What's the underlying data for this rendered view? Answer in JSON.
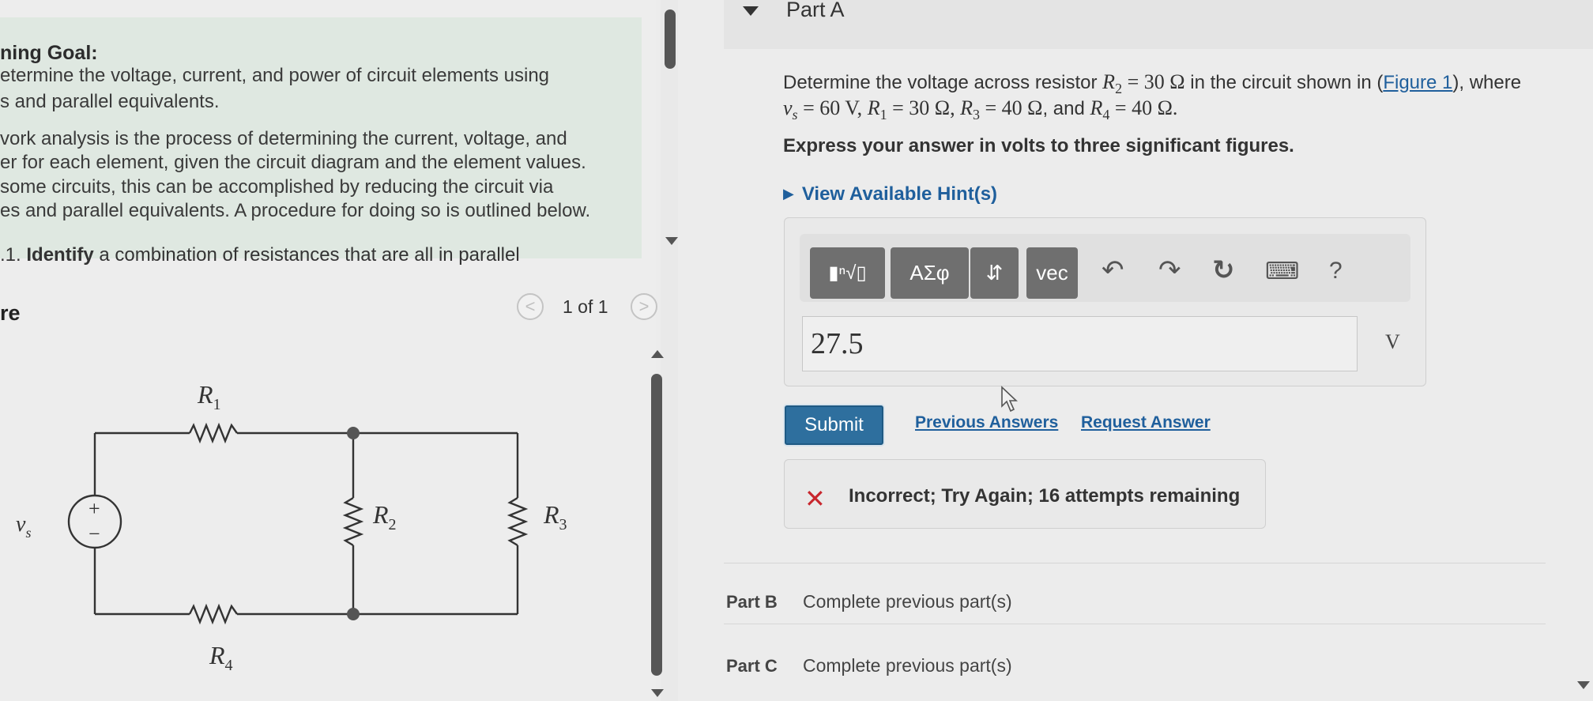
{
  "learning_goal": {
    "title": "ning Goal:",
    "lines": [
      "etermine the voltage, current, and power of circuit elements using",
      "s and parallel equivalents."
    ],
    "paragraph": [
      "vork analysis is the process of determining the current, voltage, and",
      "er for each element, given the circuit diagram and the element values.",
      "some circuits, this can be accomplished by reducing the circuit via",
      "es and parallel equivalents. A procedure for doing so is outlined below."
    ],
    "step": {
      "number": ".1.",
      "bold": "Identify",
      "rest": "a combination of resistances that are all in parallel"
    }
  },
  "figure": {
    "label": "re",
    "pager": "1 of 1",
    "prev_glyph": "<",
    "next_glyph": ">",
    "circuit": {
      "source_label": "v",
      "source_sub": "s",
      "plus": "+",
      "minus": "−",
      "r1": "R",
      "r1_sub": "1",
      "r2": "R",
      "r2_sub": "2",
      "r3": "R",
      "r3_sub": "3",
      "r4": "R",
      "r4_sub": "4"
    }
  },
  "part_a": {
    "title": "Part A",
    "question_line1_prefix": "Determine the voltage across resistor ",
    "question_line1_r2": "R",
    "question_line1_r2_sub": "2",
    "question_line1_value": " = 30 Ω",
    "question_line1_mid": " in the circuit shown in (",
    "figure_link": "Figure 1",
    "question_line1_suffix": "), where",
    "q2_vs": "v",
    "q2_vs_sub": "s",
    "q2_vs_val": " = 60 V, ",
    "q2_r1": "R",
    "q2_r1_sub": "1",
    "q2_r1_val": " = 30 Ω, ",
    "q2_r3": "R",
    "q2_r3_sub": "3",
    "q2_r3_val": " = 40 Ω",
    "q2_and": ", and ",
    "q2_r4": "R",
    "q2_r4_sub": "4",
    "q2_r4_val": " = 40 Ω.",
    "instruction": "Express your answer in volts to three significant figures.",
    "hint_glyph": "▶",
    "hint": "View Available Hint(s)",
    "toolbar": {
      "templates_glyph": "▮ⁿ√▯",
      "greek": "ΑΣφ",
      "arrows": "⇵",
      "vec": "vec",
      "undo_glyph": "↶",
      "redo_glyph": "↷",
      "reset_glyph": "↻",
      "keyboard_glyph": "⌨",
      "help": "?"
    },
    "answer_value": "27.5",
    "unit": "V",
    "submit": "Submit",
    "previous_answers": "Previous Answers",
    "request_answer": "Request Answer",
    "feedback_glyph": "✕",
    "feedback": "Incorrect; Try Again; 16 attempts remaining"
  },
  "part_b": {
    "label": "Part B",
    "status": "Complete previous part(s)"
  },
  "part_c": {
    "label": "Part C",
    "status": "Complete previous part(s)"
  },
  "colors": {
    "goal_bg": "#dfe8e1",
    "link": "#1f5f9c",
    "submit": "#2e6f9e",
    "error": "#c8262d"
  }
}
